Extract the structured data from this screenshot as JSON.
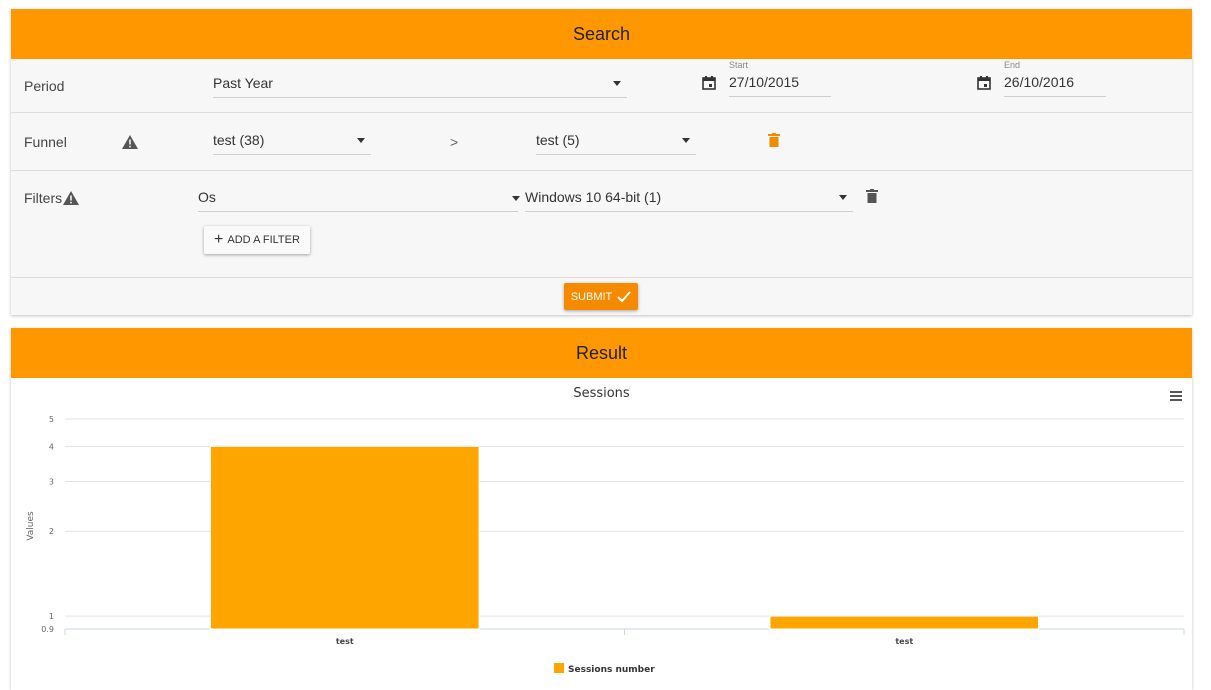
{
  "search": {
    "title": "Search",
    "period": {
      "label": "Period",
      "selected": "Past Year",
      "start_label": "Start",
      "start_value": "27/10/2015",
      "end_label": "End",
      "end_value": "26/10/2016"
    },
    "funnel": {
      "label": "Funnel",
      "step1": "test (38)",
      "arrow": ">",
      "step2": "test (5)"
    },
    "filters": {
      "label": "Filters",
      "field": "Os",
      "value": "Windows 10 64-bit (1)",
      "add_label": "ADD A FILTER",
      "add_icon": "+"
    },
    "submit_label": "SUBMIT",
    "accent_color": "#ff9800"
  },
  "result": {
    "title": "Result"
  },
  "chart_data": {
    "type": "bar",
    "title": "Sessions",
    "ylabel": "Values",
    "xlabel": "",
    "categories": [
      "test",
      "test"
    ],
    "series": [
      {
        "name": "Sessions number",
        "values": [
          4,
          1
        ],
        "color": "#ffa500"
      }
    ],
    "ylim": [
      0.9,
      5
    ],
    "yticks": [
      {
        "value": 5,
        "label": "5"
      },
      {
        "value": 4,
        "label": "4"
      },
      {
        "value": 3,
        "label": "3"
      },
      {
        "value": 2,
        "label": "2"
      },
      {
        "value": 1,
        "label": "1"
      },
      {
        "value": 0.9,
        "label": "0.9"
      }
    ],
    "y_scale": "log",
    "grid": true,
    "legend_position": "bottom"
  }
}
